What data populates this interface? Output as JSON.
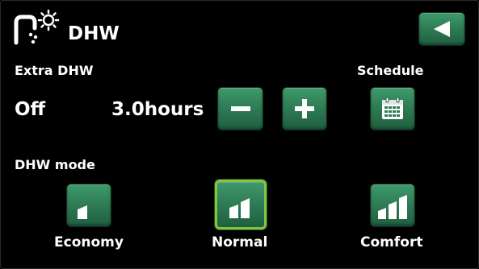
{
  "header": {
    "title": "DHW",
    "icons": {
      "title_icon": "tap-sun-icon",
      "back": "back-arrow-icon"
    }
  },
  "extra_dhw": {
    "label": "Extra DHW",
    "state": "Off",
    "duration": "3.0hours",
    "icons": {
      "decrease": "minus-icon",
      "increase": "plus-icon"
    }
  },
  "schedule": {
    "label": "Schedule",
    "icon": "calendar-icon"
  },
  "dhw_mode": {
    "label": "DHW mode",
    "selected": "Normal",
    "options": [
      {
        "label": "Economy",
        "icon": "one-bar-icon"
      },
      {
        "label": "Normal",
        "icon": "two-bars-icon"
      },
      {
        "label": "Comfort",
        "icon": "three-bars-icon"
      }
    ]
  },
  "colors": {
    "background": "#000000",
    "button_green": "#2f7d56",
    "selected_outline": "#84c441",
    "text": "#ffffff"
  }
}
